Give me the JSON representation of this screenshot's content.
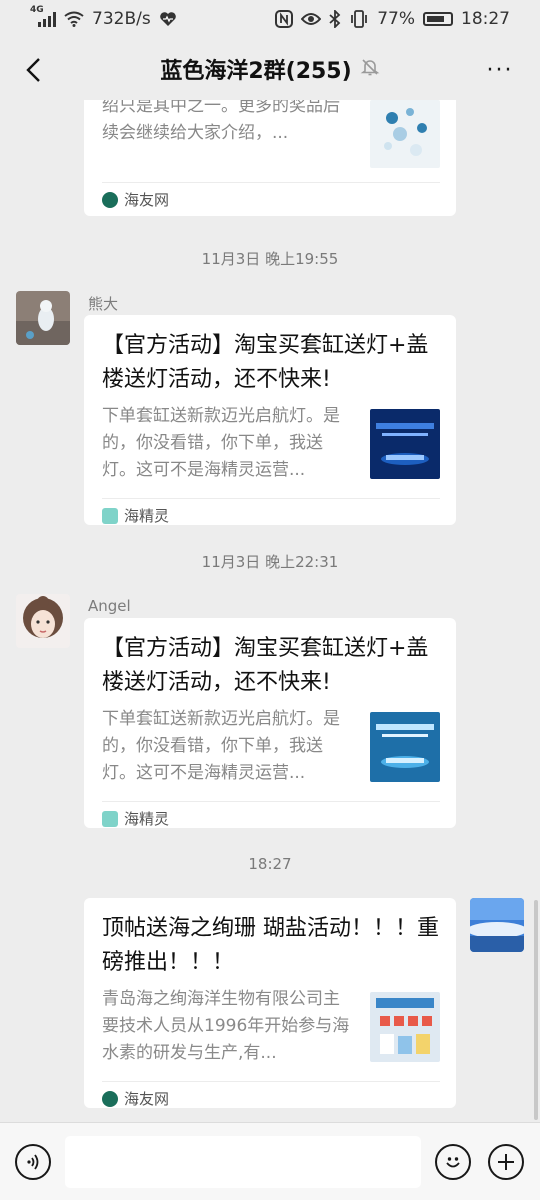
{
  "status_bar": {
    "network_type": "4G",
    "speed": "732B/s",
    "battery": "77%",
    "time": "18:27"
  },
  "header": {
    "title": "蓝色海洋2群(255)",
    "more": "···"
  },
  "messages": [
    {
      "desc": "本次开缸大赛奖品众多，此贴介绍只是其中之一。更多的奖品后续会继续给大家介绍，...",
      "source": "海友网"
    },
    {
      "time": "11月3日 晚上19:55",
      "sender": "熊大",
      "title": "【官方活动】淘宝买套缸送灯+盖楼送灯活动，还不快来!",
      "desc": "下单套缸送新款迈光启航灯。是的，你没看错，你下单，我送灯。这可不是海精灵运营...",
      "source": "海精灵"
    },
    {
      "time": "11月3日 晚上22:31",
      "sender": "Angel",
      "title": "【官方活动】淘宝买套缸送灯+盖楼送灯活动，还不快来!",
      "desc": "下单套缸送新款迈光启航灯。是的，你没看错，你下单，我送灯。这可不是海精灵运营...",
      "source": "海精灵"
    },
    {
      "time": "18:27",
      "title": "顶帖送海之绚珊 瑚盐活动！！！重磅推出！！！",
      "desc": "青岛海之绚海洋生物有限公司主要技术人员从1996年开始参与海水素的研发与生产,有...",
      "source": "海友网"
    }
  ],
  "colors": {
    "chat_bg": "#ededed",
    "card_bg": "#ffffff",
    "muted_text": "#888888",
    "source_green": "#1a6e5a",
    "source_teal": "#7fd3c9"
  }
}
